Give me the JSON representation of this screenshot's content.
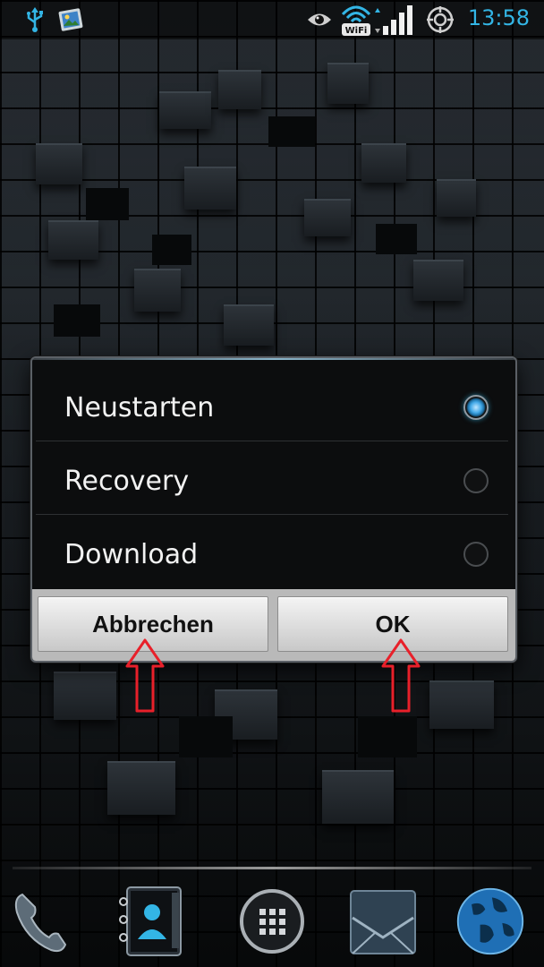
{
  "status_bar": {
    "time": "13:58",
    "left_icons": [
      "usb-icon",
      "gallery-notification-icon"
    ],
    "right_icons": [
      "eye-icon",
      "wifi-icon",
      "signal-bars-icon",
      "sync-icon"
    ],
    "wifi_label": "WiFi",
    "accent_color": "#33b5e5"
  },
  "dialog": {
    "options": [
      {
        "label": "Neustarten",
        "selected": true
      },
      {
        "label": "Recovery",
        "selected": false
      },
      {
        "label": "Download",
        "selected": false
      }
    ],
    "buttons": {
      "cancel_label": "Abbrechen",
      "ok_label": "OK"
    }
  },
  "annotations": {
    "arrow_color": "#e8202a",
    "targets": [
      "cancel-button",
      "ok-button"
    ]
  },
  "dock": {
    "items": [
      "phone-icon",
      "contacts-icon",
      "app-drawer-icon",
      "messaging-icon",
      "browser-globe-icon"
    ]
  }
}
